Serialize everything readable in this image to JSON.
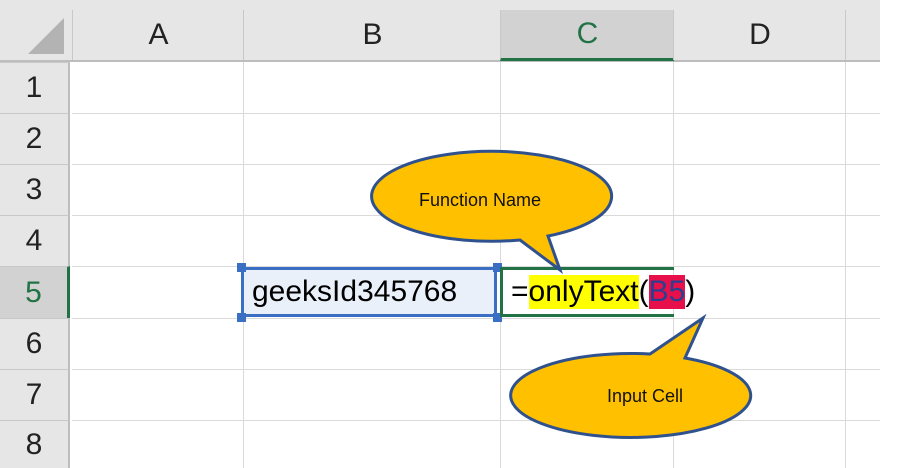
{
  "columns": [
    "A",
    "B",
    "C",
    "D"
  ],
  "rows": [
    "1",
    "2",
    "3",
    "4",
    "5",
    "6",
    "7",
    "8"
  ],
  "selected_column": "C",
  "selected_row": "5",
  "cells": {
    "B5": "geeksId345768",
    "C5": {
      "prefix": "=",
      "function": "onlyText",
      "open": "(",
      "ref": "B5",
      "close": ")"
    }
  },
  "callouts": {
    "function_name": "Function Name",
    "input_cell": "Input Cell"
  },
  "colors": {
    "callout_fill": "#FFC000",
    "callout_border": "#2F528F",
    "function_highlight": "#FFFF00",
    "ref_highlight": "#E8104A",
    "selection_green": "#217346"
  }
}
